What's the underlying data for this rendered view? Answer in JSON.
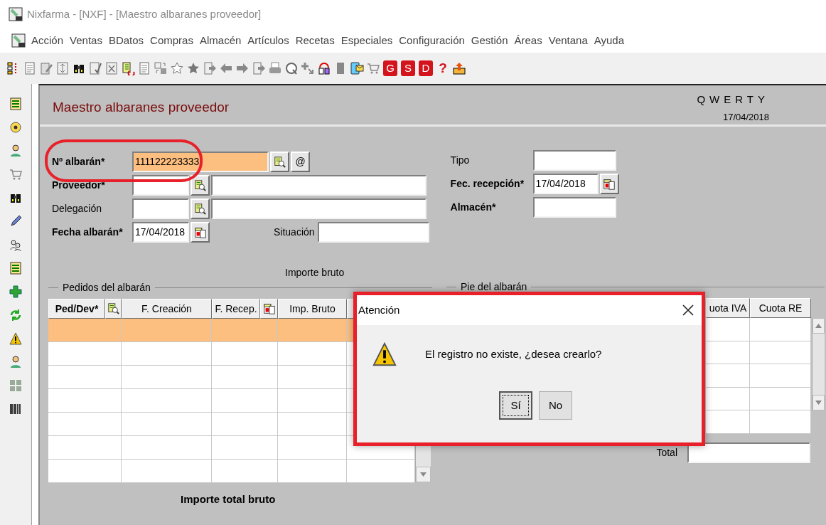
{
  "window": {
    "title": "Nixfarma - [NXF] - [Maestro albaranes proveedor]"
  },
  "menu": [
    "Acción",
    "Ventas",
    "BDatos",
    "Compras",
    "Almacén",
    "Artículos",
    "Recetas",
    "Especiales",
    "Configuración",
    "Gestión",
    "Áreas",
    "Ventana",
    "Ayuda"
  ],
  "toolbar_letters": [
    {
      "text": "G",
      "kind": "badge"
    },
    {
      "text": "S",
      "kind": "badge"
    },
    {
      "text": "D",
      "kind": "badge"
    },
    {
      "text": "?",
      "kind": "glyph"
    }
  ],
  "header": {
    "title": "Maestro albaranes proveedor",
    "user": "QWERTY",
    "date": "17/04/2018"
  },
  "form_left": [
    {
      "kind": "code",
      "label": "Nº albarán*",
      "required": true,
      "value": "111122223333",
      "focused": true,
      "extra_button": "@"
    },
    {
      "kind": "lookup",
      "label": "Proveedor*",
      "required": true
    },
    {
      "kind": "lookup",
      "label": "Delegación",
      "required": false
    },
    {
      "kind": "date",
      "label": "Fecha albarán*",
      "required": true,
      "value": "17/04/2018",
      "side_label": "Situación"
    }
  ],
  "form_right": [
    {
      "kind": "text",
      "label": "Tipo",
      "required": false
    },
    {
      "kind": "date",
      "label": "Fec. recepción*",
      "required": true,
      "value": "17/04/2018"
    },
    {
      "kind": "text",
      "label": "Almacén*",
      "required": true
    }
  ],
  "orders": {
    "amount_caption": "Importe bruto",
    "legend": "Pedidos del albarán",
    "columns": [
      {
        "label": "Ped/Dev*",
        "required": true,
        "kind": "lookup"
      },
      {
        "label": "F. Creación",
        "required": false,
        "kind": "plain"
      },
      {
        "label": "F. Recep.",
        "required": false,
        "kind": "calendar"
      },
      {
        "label": "Imp. Bruto",
        "required": false,
        "kind": "plain"
      }
    ],
    "rows": [
      {
        "selected": true
      },
      {
        "selected": false
      },
      {
        "selected": false
      },
      {
        "selected": false
      },
      {
        "selected": false
      },
      {
        "selected": false
      },
      {
        "selected": false
      }
    ],
    "total_label": "Importe total bruto"
  },
  "footer": {
    "legend": "Pie del albarán",
    "columns": [
      "uota IVA",
      "Cuota RE"
    ],
    "total_label": "Total"
  },
  "dialog": {
    "title": "Atención",
    "message": "El registro no existe, ¿desea crearlo?",
    "buttons": [
      {
        "label": "Sí",
        "default": true
      },
      {
        "label": "No",
        "default": false
      }
    ]
  }
}
